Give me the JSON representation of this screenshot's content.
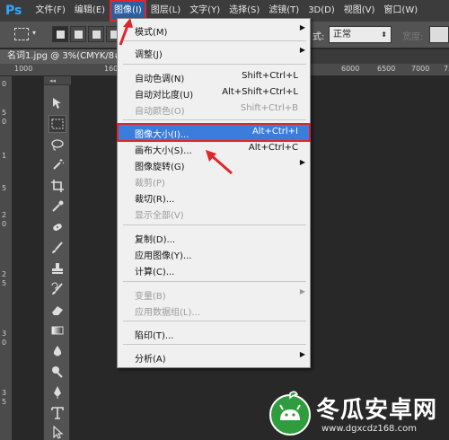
{
  "app": {
    "logo": "Ps"
  },
  "menubar": {
    "items": [
      {
        "label": "文件(F)"
      },
      {
        "label": "编辑(E)"
      },
      {
        "label": "图像(I)"
      },
      {
        "label": "图层(L)"
      },
      {
        "label": "文字(Y)"
      },
      {
        "label": "选择(S)"
      },
      {
        "label": "滤镜(T)"
      },
      {
        "label": "3D(D)"
      },
      {
        "label": "视图(V)"
      },
      {
        "label": "窗口(W)"
      }
    ],
    "active_index": 2
  },
  "options_bar": {
    "style_label": "式:",
    "style_value": "正常",
    "width_label": "宽度:"
  },
  "document": {
    "tab_label": "名词1.jpg @ 3%(CMYK/8#"
  },
  "ruler": {
    "top_numbers": [
      "1000",
      "1600",
      "6000",
      "6500",
      "7000",
      "7500"
    ],
    "left_numbers": [
      "0",
      "5",
      "0",
      "1",
      "5",
      "2",
      "0",
      "2",
      "5",
      "3",
      "0",
      "3",
      "5"
    ]
  },
  "toolbox": {
    "tools": [
      {
        "icon": "move-icon"
      },
      {
        "icon": "marquee-icon"
      },
      {
        "icon": "lasso-icon"
      },
      {
        "icon": "magic-wand-icon"
      },
      {
        "icon": "crop-icon"
      },
      {
        "icon": "eyedropper-icon"
      },
      {
        "icon": "healing-brush-icon"
      },
      {
        "icon": "brush-icon"
      },
      {
        "icon": "clone-stamp-icon"
      },
      {
        "icon": "history-brush-icon"
      },
      {
        "icon": "eraser-icon"
      },
      {
        "icon": "gradient-icon"
      },
      {
        "icon": "blur-icon"
      },
      {
        "icon": "dodge-icon"
      },
      {
        "icon": "pen-icon"
      },
      {
        "icon": "type-icon"
      },
      {
        "icon": "path-selection-icon"
      }
    ]
  },
  "image_menu": {
    "items": [
      {
        "label": "模式(M)",
        "shortcut": "",
        "submenu": true,
        "disabled": false
      },
      {
        "label": "调整(J)",
        "shortcut": "",
        "submenu": true,
        "disabled": false
      },
      {
        "label": "自动色调(N)",
        "shortcut": "Shift+Ctrl+L",
        "submenu": false,
        "disabled": false
      },
      {
        "label": "自动对比度(U)",
        "shortcut": "Alt+Shift+Ctrl+L",
        "submenu": false,
        "disabled": false
      },
      {
        "label": "自动颜色(O)",
        "shortcut": "Shift+Ctrl+B",
        "submenu": false,
        "disabled": true
      },
      {
        "label": "图像大小(I)...",
        "shortcut": "Alt+Ctrl+I",
        "submenu": false,
        "disabled": false,
        "highlighted": true
      },
      {
        "label": "画布大小(S)...",
        "shortcut": "Alt+Ctrl+C",
        "submenu": false,
        "disabled": false
      },
      {
        "label": "图像旋转(G)",
        "shortcut": "",
        "submenu": true,
        "disabled": false
      },
      {
        "label": "裁剪(P)",
        "shortcut": "",
        "submenu": false,
        "disabled": true
      },
      {
        "label": "裁切(R)...",
        "shortcut": "",
        "submenu": false,
        "disabled": false
      },
      {
        "label": "显示全部(V)",
        "shortcut": "",
        "submenu": false,
        "disabled": true
      },
      {
        "label": "复制(D)...",
        "shortcut": "",
        "submenu": false,
        "disabled": false
      },
      {
        "label": "应用图像(Y)...",
        "shortcut": "",
        "submenu": false,
        "disabled": false
      },
      {
        "label": "计算(C)...",
        "shortcut": "",
        "submenu": false,
        "disabled": false
      },
      {
        "label": "变量(B)",
        "shortcut": "",
        "submenu": true,
        "disabled": true
      },
      {
        "label": "应用数据组(L)...",
        "shortcut": "",
        "submenu": false,
        "disabled": true
      },
      {
        "label": "陷印(T)...",
        "shortcut": "",
        "submenu": false,
        "disabled": false
      },
      {
        "label": "分析(A)",
        "shortcut": "",
        "submenu": true,
        "disabled": false
      }
    ]
  },
  "watermark": {
    "title": "冬瓜安卓网",
    "url": "www.dgxcdz168.com"
  }
}
